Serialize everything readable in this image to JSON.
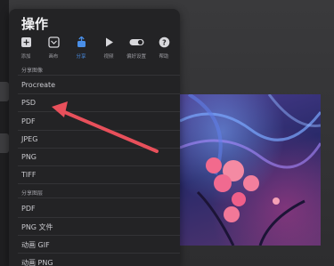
{
  "menu": {
    "title": "操作",
    "tabs": [
      {
        "label": "添加",
        "icon": "add-icon"
      },
      {
        "label": "画布",
        "icon": "canvas-icon"
      },
      {
        "label": "分享",
        "icon": "share-icon"
      },
      {
        "label": "视频",
        "icon": "video-play-icon"
      },
      {
        "label": "偏好设置",
        "icon": "toggle-icon"
      },
      {
        "label": "帮助",
        "icon": "help-icon"
      }
    ],
    "active_tab": "分享",
    "accent_color": "#4a8fe8",
    "section_image": "分享图像",
    "image_items": [
      "Procreate",
      "PSD",
      "PDF",
      "JPEG",
      "PNG",
      "TIFF"
    ],
    "section_layers": "分享图层",
    "layer_items": [
      "PDF",
      "PNG 文件",
      "动画 GIF",
      "动画 PNG"
    ]
  },
  "annotation": {
    "arrow_color": "#e8505b"
  }
}
